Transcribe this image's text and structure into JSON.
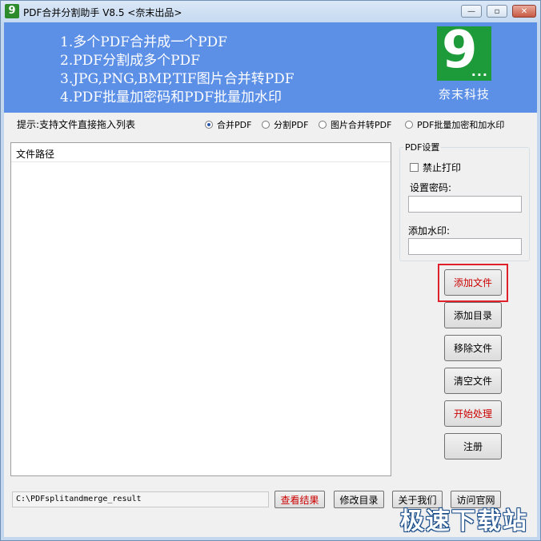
{
  "window": {
    "title": "PDF合并分割助手 V8.5 <奈末出品>",
    "minimize_glyph": "—",
    "restore_glyph": "▫",
    "close_glyph": "✕"
  },
  "banner": {
    "lines": [
      "1.多个PDF合并成一个PDF",
      "2.PDF分割成多个PDF",
      "3.JPG,PNG,BMP,TIF图片合并转PDF",
      "4.PDF批量加密码和PDF批量加水印"
    ],
    "logo_text": "奈末科技",
    "logo_glyph": "9",
    "logo_dots": "..."
  },
  "hint": "提示:支持文件直接拖入列表",
  "modes": [
    {
      "label": "合并PDF",
      "selected": true
    },
    {
      "label": "分割PDF",
      "selected": false
    },
    {
      "label": "图片合并转PDF",
      "selected": false
    },
    {
      "label": "PDF批量加密和加水印",
      "selected": false
    }
  ],
  "file_list": {
    "column_header": "文件路径",
    "rows": []
  },
  "pdf_settings": {
    "group_title": "PDF设置",
    "disable_print_label": "禁止打印",
    "disable_print_checked": false,
    "password_label": "设置密码:",
    "password_value": "",
    "watermark_label": "添加水印:",
    "watermark_value": ""
  },
  "buttons": {
    "add_file": "添加文件",
    "add_folder": "添加目录",
    "remove_file": "移除文件",
    "clear_files": "清空文件",
    "start": "开始处理",
    "register": "注册"
  },
  "footer": {
    "output_path": "C:\\PDFsplitandmerge_result",
    "view_result": "查看结果",
    "change_dir": "修改目录",
    "about": "关于我们",
    "visit_site": "访问官网"
  },
  "watermark_text": "极速下载站",
  "colors": {
    "banner": "#5c8fe6",
    "logo": "#1d9a3a",
    "accent_red": "#cc0000",
    "highlight": "#e0202a"
  }
}
